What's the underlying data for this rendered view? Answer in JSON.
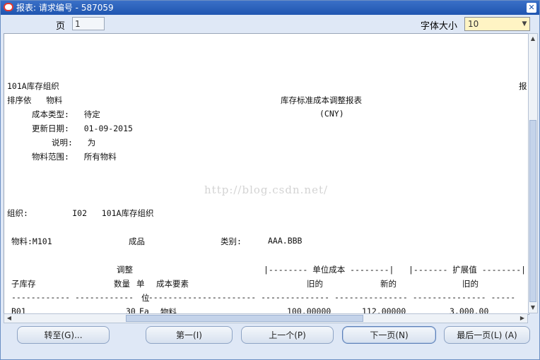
{
  "window": {
    "title": "报表: 请求编号 - 587059"
  },
  "toolbar": {
    "page_label": "页",
    "page_value": "1",
    "font_size_label": "字体大小",
    "font_size_value": "10"
  },
  "report": {
    "lines": {
      "org_header": "101A库存组织",
      "report_right": "报",
      "sort_by": "排序依   物料",
      "title": "库存标准成本调整报表",
      "currency": "(CNY)",
      "cost_type": "成本类型:   待定",
      "update_date": "更新日期:   01-09-2015",
      "description": "说明:   为",
      "item_range": "物料范围:   所有物料",
      "watermark": "http://blog.csdn.net/",
      "organization": "组织:         I02   101A库存组织",
      "item": "物料:M101",
      "item_type": "成品",
      "category_label": "类别:",
      "category_value": "AAA.BBB",
      "hdr_adjust": "调整",
      "hdr_unit_cost": "|-------- 单位成本 --------|",
      "hdr_ext_value": "|------- 扩展值 --------|",
      "hdr_subinv": "子库存",
      "hdr_qty": "数量",
      "hdr_unit": "单",
      "hdr_cost_elem": "成本要素",
      "hdr_old1": "旧的",
      "hdr_new1": "新的",
      "hdr_old2": "旧的",
      "dashes": "------------ ------------  ----------------------- -------------- --------------- --------------- -----",
      "hdr_unit2": "位",
      "row_subinv": "B01",
      "row_qty": "30",
      "row_unit": "Ea",
      "row_elem": "物料",
      "row_old": "100.00000",
      "row_new": "112.00000",
      "row_ext": "3,000.00"
    }
  },
  "buttons": {
    "goto": "转至(G)...",
    "first": "第一(I)",
    "prev": "上一个(P)",
    "next": "下一页(N)",
    "last": "最后一页(L)  (A)"
  }
}
